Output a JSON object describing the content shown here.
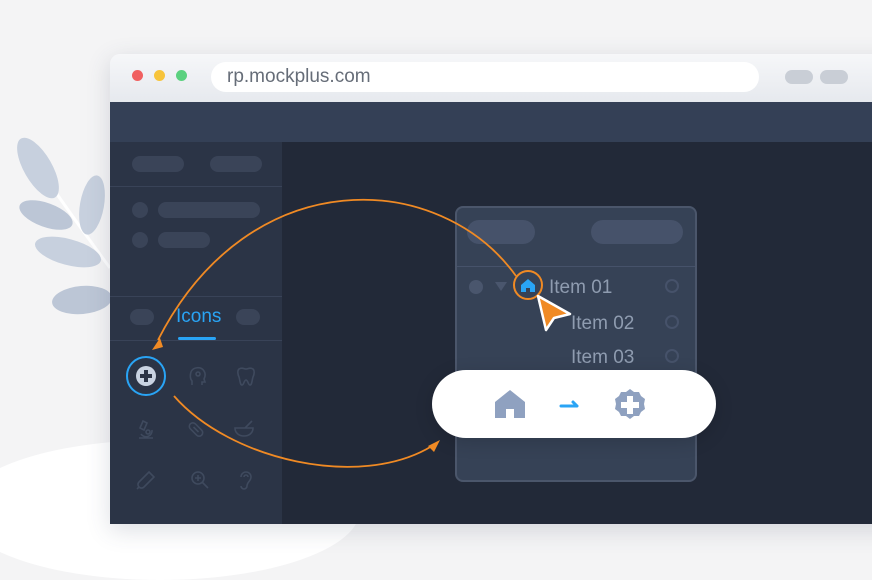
{
  "browser": {
    "url": "rp.mockplus.com",
    "traffic_lights": [
      "#f06060",
      "#f7c43b",
      "#5bd17f"
    ]
  },
  "sidebar": {
    "active_tab_label": "Icons",
    "icon_grid": [
      [
        "medical-cross-icon",
        "head-profile-icon",
        "tooth-icon"
      ],
      [
        "microscope-icon",
        "pill-capsule-icon",
        "mortar-pestle-icon"
      ],
      [
        "thermometer-icon",
        "zoom-plus-icon",
        "ear-icon"
      ]
    ]
  },
  "panel": {
    "items": [
      {
        "label": "Item 01"
      },
      {
        "label": "Item 02"
      },
      {
        "label": "Item 03"
      }
    ]
  },
  "replace_popup": {
    "from_icon": "home-icon",
    "to_icon": "medical-cross-icon"
  },
  "colors": {
    "accent": "#29a4f5",
    "arrow": "#f08a24",
    "sidebar": "#2b3446",
    "canvas": "#222938"
  }
}
